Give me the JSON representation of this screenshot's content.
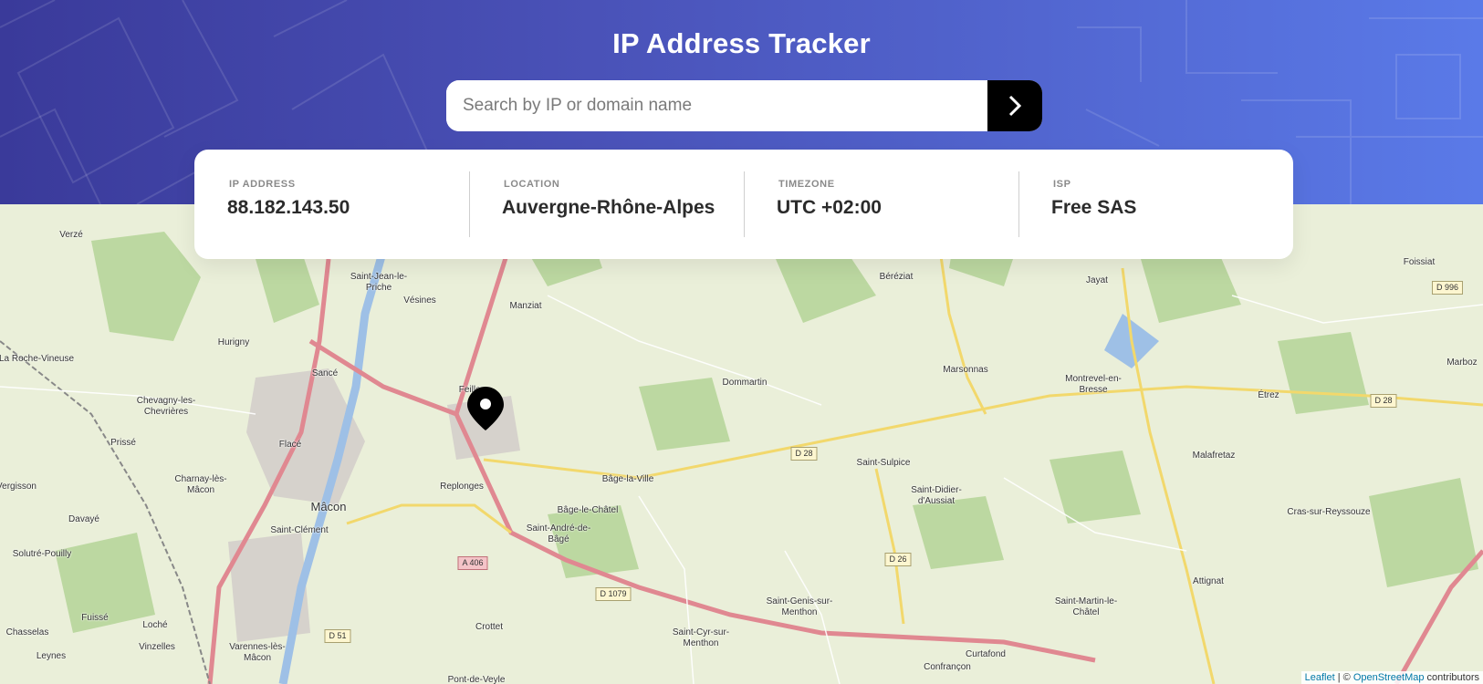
{
  "app": {
    "title": "IP Address Tracker"
  },
  "search": {
    "placeholder": "Search by IP or domain name",
    "value": ""
  },
  "info": [
    {
      "label": "IP Address",
      "value": "88.182.143.50"
    },
    {
      "label": "Location",
      "value": "Auvergne-Rhône-Alpes"
    },
    {
      "label": "Timezone",
      "value": "UTC +02:00"
    },
    {
      "label": "ISP",
      "value": "Free SAS"
    }
  ],
  "map": {
    "places": [
      "Verzé",
      "Saint-Jean-le-Priche",
      "Vésines",
      "Manziat",
      "Béréziat",
      "Jayat",
      "Foissiat",
      "Hurigny",
      "Sancé",
      "Chevagny-les-Chevrières",
      "Dommartin",
      "Marsonnas",
      "Montrevel-en-Bresse",
      "Étrez",
      "Marboz",
      "Prissé",
      "Flacé",
      "Charnay-lès-Mâcon",
      "Mâcon",
      "Saint-Clément",
      "Replonges",
      "Bâge-la-Ville",
      "Bâge-le-Châtel",
      "Saint-André-de-Bâgé",
      "Saint-Sulpice",
      "Saint-Didier-d'Aussiat",
      "Malafretaz",
      "Cras-sur-Reyssouze",
      "Attignat",
      "Vergisson",
      "Davayé",
      "Solutré-Pouilly",
      "Fuissé",
      "Loché",
      "Chasselas",
      "Vinzelles",
      "Leynes",
      "Varennes-lès-Mâcon",
      "Crottet",
      "Saint-Genis-sur-Menthon",
      "Saint-Cyr-sur-Menthon",
      "Saint-Martin-le-Châtel",
      "Curtafond",
      "Confrançon",
      "Pont-de-Veyle",
      "La Roche-Vineuse"
    ],
    "roads": [
      "D 996",
      "D 28",
      "D 28",
      "A 406",
      "D 1079",
      "D 26",
      "D 51"
    ],
    "marker_label": "Feillens"
  },
  "attribution": {
    "leaflet": "Leaflet",
    "separator": " | © ",
    "osm": "OpenStreetMap",
    "suffix": " contributors"
  },
  "colors": {
    "header_start": "#3a3a9a",
    "header_end": "#5a7ae8",
    "button": "#000000",
    "text_dark": "#2b2b2b",
    "label_gray": "#8a8a8a"
  },
  "icons": {
    "search_button": "chevron-right-icon",
    "marker": "location-pin-icon"
  }
}
